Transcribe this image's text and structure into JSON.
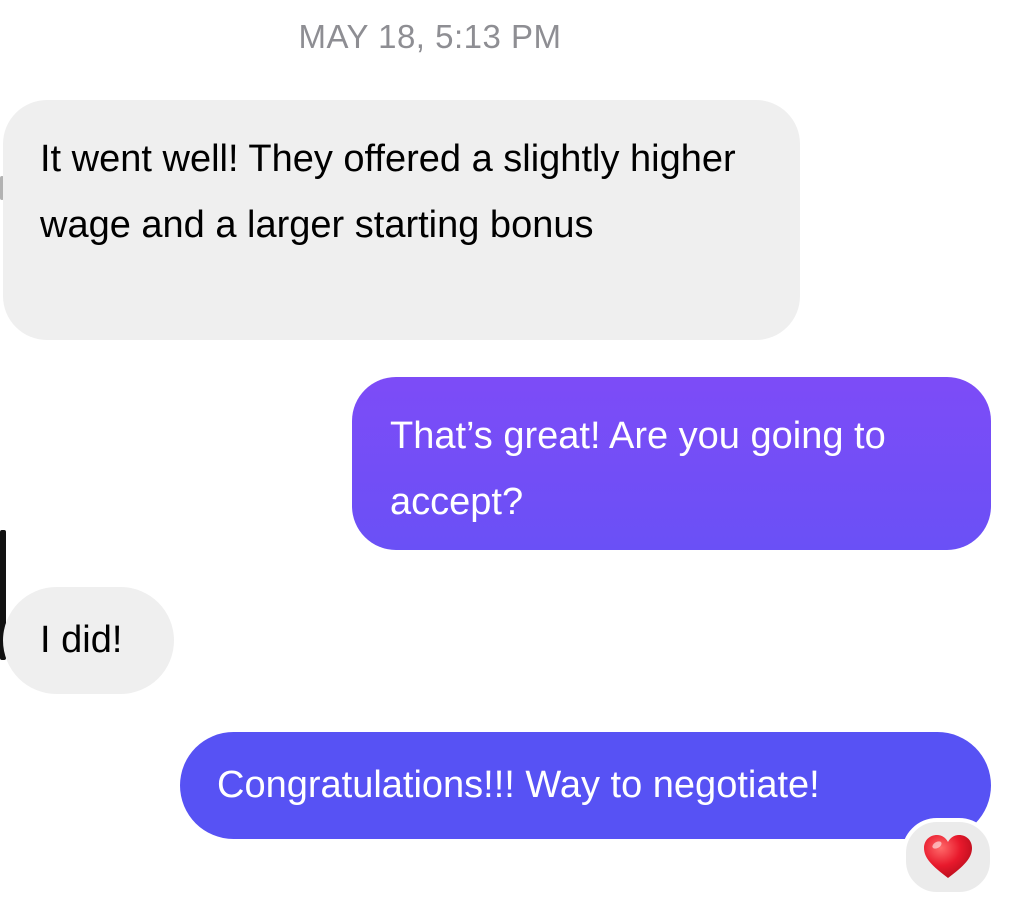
{
  "conversation": {
    "timestamp": "MAY 18, 5:13 PM",
    "messages": [
      {
        "sender": "them",
        "text": "It went well! They offered a slightly higher wage and a larger starting bonus"
      },
      {
        "sender": "me",
        "text": "That’s great! Are you going to accept?"
      },
      {
        "sender": "them",
        "text": "I did!"
      },
      {
        "sender": "me",
        "text": "Congratulations!!! Way to negotiate!",
        "reaction": "red-heart-icon"
      }
    ]
  },
  "colors": {
    "incoming_bubble": "#efefef",
    "outgoing_gradient_top": "#7d4cf7",
    "outgoing_gradient_bottom": "#6a50f6",
    "outgoing_latest": "#5752f4",
    "timestamp_text": "#8e8e93",
    "reaction_heart": "#e0162b"
  }
}
